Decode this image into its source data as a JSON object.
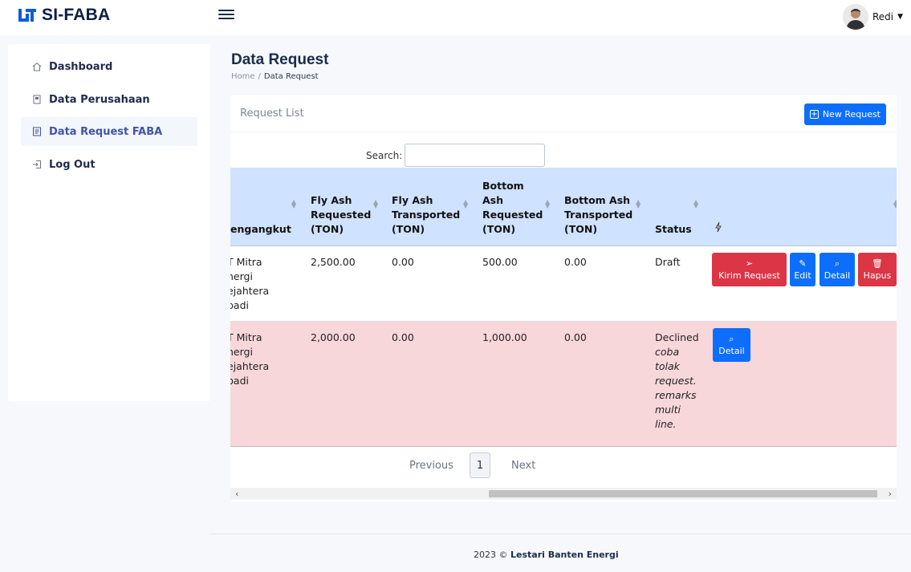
{
  "app": {
    "brand": "SI-FABA",
    "brand_color": "#0b1f47",
    "accent_color": "#0d6efd"
  },
  "user": {
    "name": "Redi"
  },
  "sidebar": {
    "items": [
      {
        "label": "Dashboard",
        "icon": "home-icon",
        "active": false
      },
      {
        "label": "Data Perusahaan",
        "icon": "building-icon",
        "active": false
      },
      {
        "label": "Data Request FABA",
        "icon": "document-icon",
        "active": true
      },
      {
        "label": "Log Out",
        "icon": "logout-icon",
        "active": false
      }
    ]
  },
  "page": {
    "title": "Data Request",
    "breadcrumb": {
      "home": "Home",
      "separator": "/",
      "current": "Data Request"
    }
  },
  "card": {
    "title": "Request List",
    "new_button": "New Request",
    "search_label": "Search:",
    "search_value": ""
  },
  "table": {
    "headers": {
      "pengangkut": "engangkut",
      "fly_req": [
        "Fly Ash",
        "Requested",
        "(TON)"
      ],
      "fly_trans": [
        "Fly Ash",
        "Transported",
        "(TON)"
      ],
      "bottom_req": [
        "Bottom",
        "Ash",
        "Requested",
        "(TON)"
      ],
      "bottom_trans": [
        "Bottom Ash",
        "Transported",
        "(TON)"
      ],
      "status": "Status",
      "action_icon": "lightning-icon"
    },
    "rows": [
      {
        "pengangkut": [
          "T Mitra",
          "nergi",
          "ejahtera",
          "badi"
        ],
        "fly_req": "2,500.00",
        "fly_trans": "0.00",
        "bottom_req": "500.00",
        "bottom_trans": "0.00",
        "status": "Draft",
        "remark": [],
        "buttons": [
          {
            "label": "Kirim Request",
            "icon": "send-icon",
            "color": "#dc3545"
          },
          {
            "label": "Edit",
            "icon": "pencil-icon",
            "color": "#0d6efd"
          },
          {
            "label": "Detail",
            "icon": "search-icon",
            "color": "#0d6efd"
          },
          {
            "label": "Hapus",
            "icon": "trash-icon",
            "color": "#dc3545"
          }
        ]
      },
      {
        "pengangkut": [
          "T Mitra",
          "nergi",
          "ejahtera",
          "badi"
        ],
        "fly_req": "2,000.00",
        "fly_trans": "0.00",
        "bottom_req": "1,000.00",
        "bottom_trans": "0.00",
        "status": "Declined",
        "remark": [
          "coba",
          "tolak",
          "request.",
          "remarks",
          "multi",
          "line."
        ],
        "buttons": [
          {
            "label": "Detail",
            "icon": "search-icon",
            "color": "#0d6efd"
          }
        ]
      }
    ]
  },
  "pagination": {
    "previous": "Previous",
    "current": "1",
    "next": "Next"
  },
  "footer": {
    "text": "2023 ©",
    "company": "Lestari Banten Energi"
  }
}
